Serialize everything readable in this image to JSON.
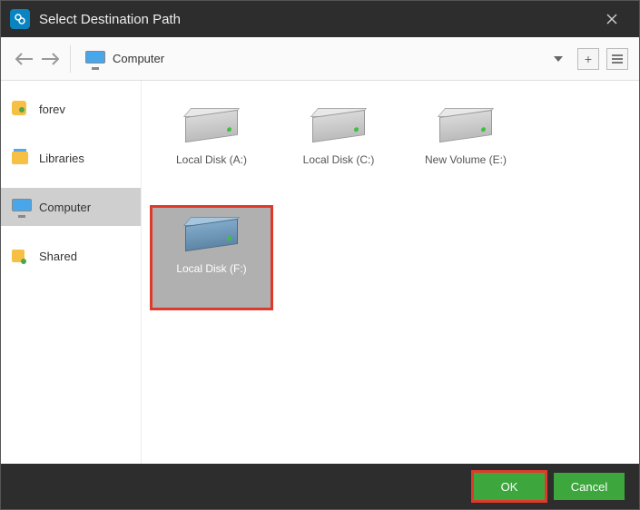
{
  "title": "Select Destination Path",
  "location": "Computer",
  "sidebar": {
    "items": [
      {
        "label": "forev"
      },
      {
        "label": "Libraries"
      },
      {
        "label": "Computer"
      },
      {
        "label": "Shared"
      }
    ]
  },
  "drives": [
    {
      "label": "Local Disk (A:)"
    },
    {
      "label": "Local Disk (C:)"
    },
    {
      "label": "New Volume (E:)"
    },
    {
      "label": "Local Disk (F:)"
    }
  ],
  "footer": {
    "ok": "OK",
    "cancel": "Cancel"
  }
}
